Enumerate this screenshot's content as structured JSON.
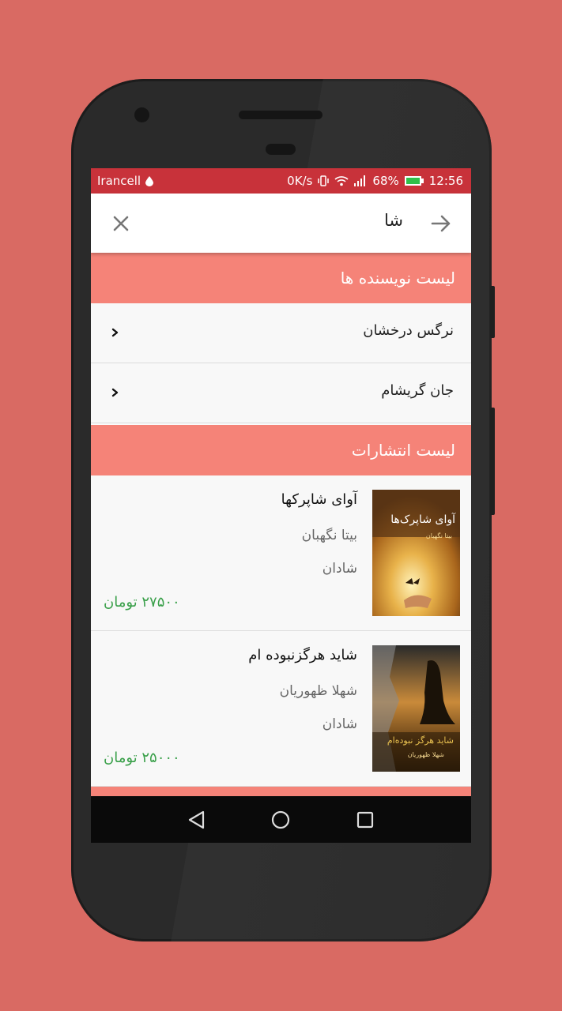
{
  "status_bar": {
    "carrier": "Irancell",
    "speed": "0K/s",
    "battery": "68%",
    "time": "12:56"
  },
  "search": {
    "query": "شا"
  },
  "authors_section": {
    "title": "لیست نویسنده ها",
    "items": [
      {
        "label": "نرگس درخشان"
      },
      {
        "label": "جان گریشام"
      }
    ]
  },
  "publishers_section": {
    "title": "لیست انتشارات",
    "books": [
      {
        "title": "آوای شاپرکها",
        "author": "بیتا نگهبان",
        "publisher": "شادان",
        "price": "۲۷۵۰۰ تومان",
        "cover_title": "آوای شاپرک‌ها",
        "cover_author": "بیتا نگهبان"
      },
      {
        "title": "شاید هرگزنبوده ام",
        "author": "شهلا ظهوریان",
        "publisher": "شادان",
        "price": "۲۵۰۰۰ تومان",
        "cover_title": "شاید هرگز نبوده‌ام",
        "cover_author": "شهلا ظهوریان"
      }
    ]
  },
  "colors": {
    "background": "#d96a63",
    "status_bar": "#c8323a",
    "section_header": "#f58378",
    "price": "#3aa04a"
  },
  "icons": {
    "close": "close-icon",
    "back": "arrow-right-icon",
    "chevron": "chevron-right-icon",
    "nav_back": "triangle-back-icon",
    "nav_home": "circle-home-icon",
    "nav_recents": "square-recents-icon"
  }
}
